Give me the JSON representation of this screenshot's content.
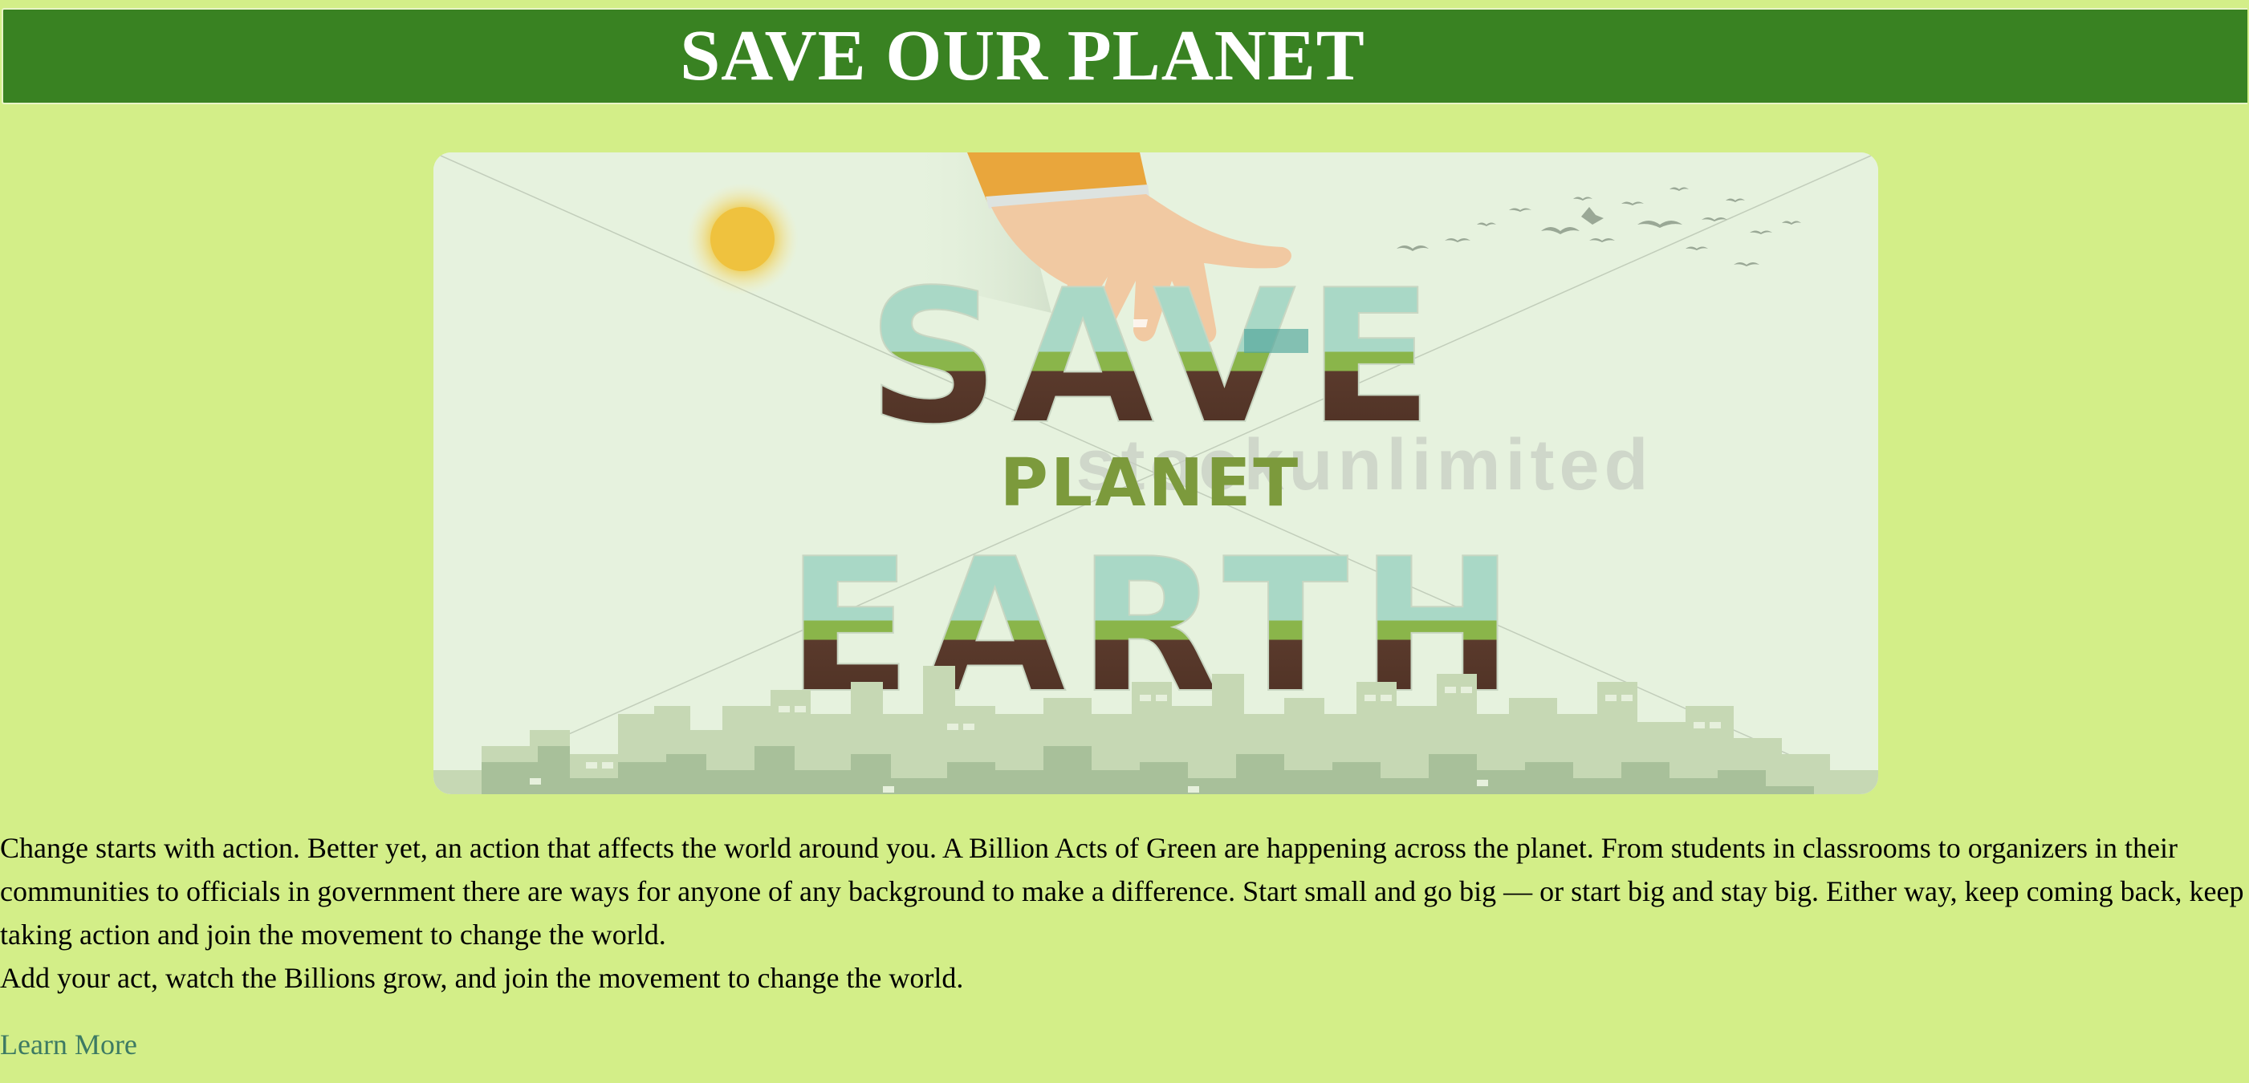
{
  "header": {
    "title": "SAVE OUR PLANET"
  },
  "hero_image": {
    "line1": "SAVE",
    "line2": "PLANET",
    "line3": "EARTH",
    "watermark": "stockunlimited",
    "icon_names": [
      "sun-icon",
      "hand-icon",
      "birds-icon",
      "city-skyline-icon"
    ]
  },
  "content": {
    "paragraph1": "Change starts with action. Better yet, an action that affects the world around you. A Billion Acts of Green are happening across the planet. From students in classrooms to organizers in their communities to officials in government there are ways for anyone of any background to make a difference. Start small and go big — or start big and stay big. Either way, keep coming back, keep taking action and join the movement to change the world.",
    "paragraph2": "Add your act, watch the Billions grow, and join the movement to change the world."
  },
  "links": {
    "learn_more": "Learn More"
  },
  "colors": {
    "page_background": "#d3ee88",
    "banner_background": "#398222",
    "banner_text": "#ffffff",
    "link": "#3d7a63"
  }
}
